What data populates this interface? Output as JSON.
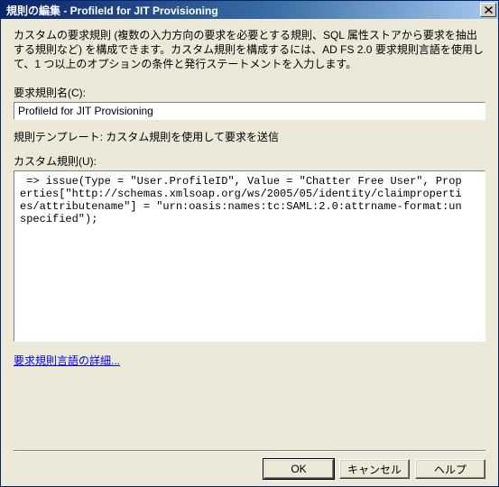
{
  "titlebar": {
    "text": "規則の編集 - ProfileId for JIT Provisioning"
  },
  "intro": "カスタムの要求規則 (複数の入力方向の要求を必要とする規則、SQL 属性ストアから要求を抽出する規則など) を構成できます。カスタム規則を構成するには、AD FS 2.0 要求規則言語を使用して、1 つ以上のオプションの条件と発行ステートメントを入力します。",
  "rule_name_label": "要求規則名(C):",
  "rule_name_value": "ProfileId for JIT Provisioning",
  "template_line": "規則テンプレート: カスタム規則を使用して要求を送信",
  "custom_rule_label": "カスタム規則(U):",
  "custom_rule_value": " => issue(Type = \"User.ProfileID\", Value = \"Chatter Free User\", Properties[\"http://schemas.xmlsoap.org/ws/2005/05/identity/claimproperties/attributename\"] = \"urn:oasis:names:tc:SAML:2.0:attrname-format:unspecified\");",
  "link_text": "要求規則言語の詳細...",
  "buttons": {
    "ok": "OK",
    "cancel": "キャンセル",
    "help": "ヘルプ"
  }
}
